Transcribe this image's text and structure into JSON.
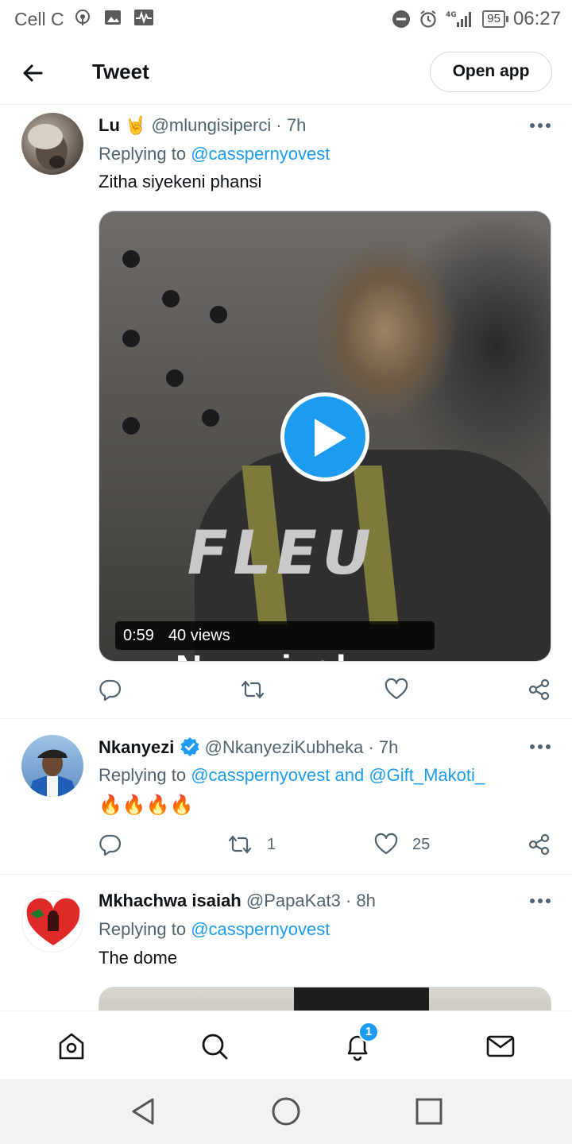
{
  "status_bar": {
    "carrier": "Cell C",
    "network": "4G",
    "battery": "95",
    "time": "06:27"
  },
  "header": {
    "title": "Tweet",
    "open_app_label": "Open app"
  },
  "tweets": [
    {
      "name": "Lu",
      "name_emoji": "🤘",
      "handle": "@mlungisiperci",
      "time": "7h",
      "replying_prefix": "Replying to",
      "mentions": "@casspernyovest",
      "text": "Zitha siyekeni phansi",
      "media": {
        "duration": "0:59",
        "views": "40 views",
        "caption": "New single",
        "logo_text": "FLEU"
      },
      "retweets": "",
      "likes": ""
    },
    {
      "name": "Nkanyezi",
      "handle": "@NkanyeziKubheka",
      "time": "7h",
      "replying_prefix": "Replying to",
      "mentions": "@casspernyovest and @Gift_Makoti_",
      "text": "🔥🔥🔥🔥",
      "retweets": "1",
      "likes": "25"
    },
    {
      "name": "Mkhachwa isaiah",
      "handle": "@PapaKat3",
      "time": "8h",
      "replying_prefix": "Replying to",
      "mentions": "@casspernyovest",
      "text": "The dome"
    }
  ],
  "bottom_nav": {
    "notifications_badge": "1"
  },
  "colors": {
    "accent": "#1d9bf0",
    "text_primary": "#0f1419",
    "text_secondary": "#536471",
    "verified": "#1d9bf0"
  }
}
